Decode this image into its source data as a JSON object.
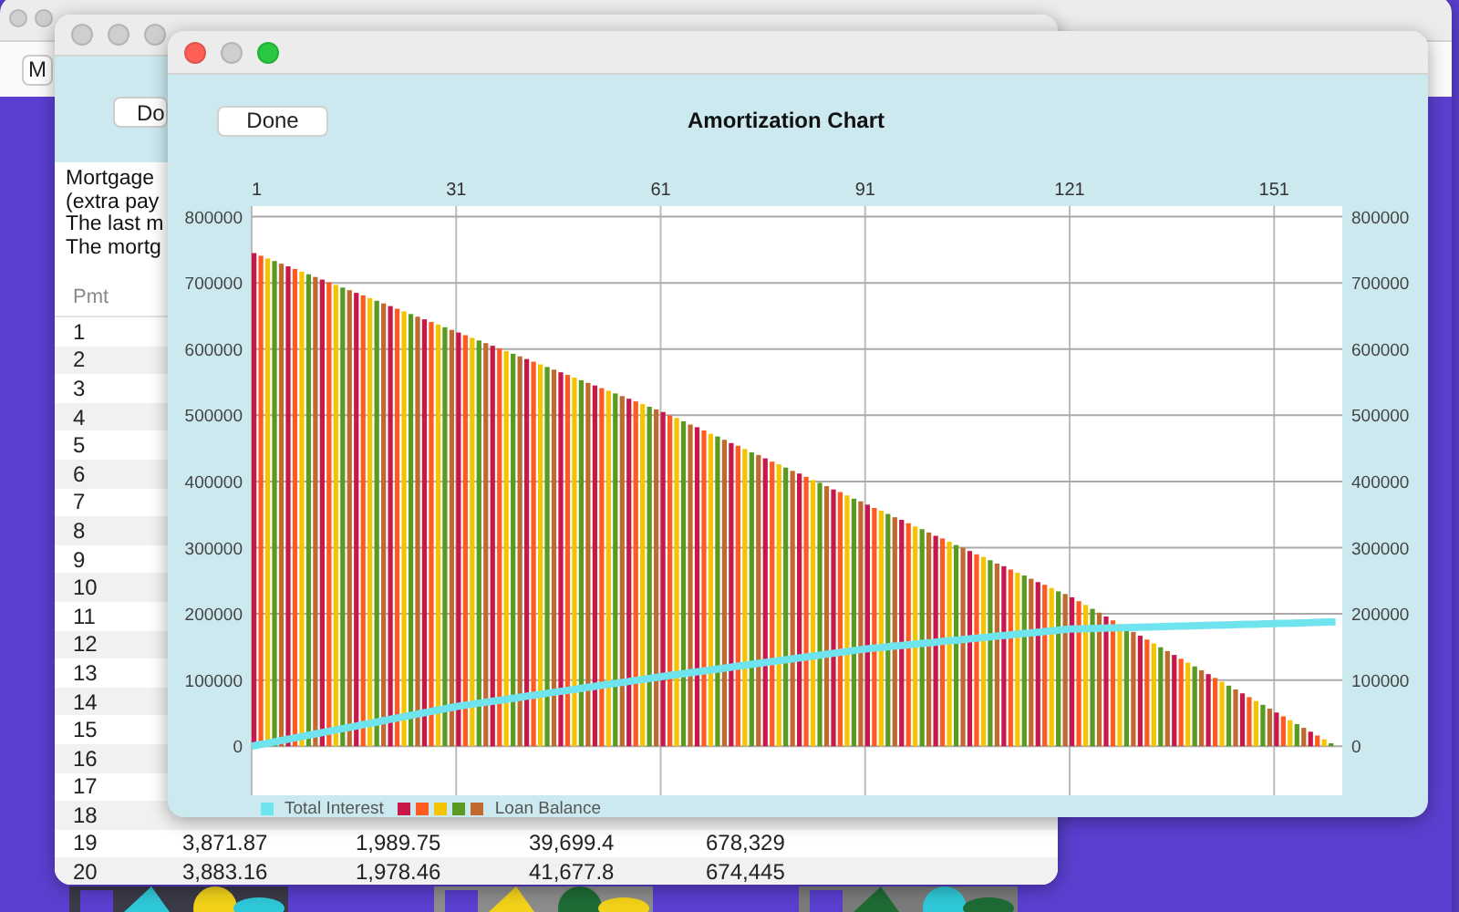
{
  "back_window": {
    "toolbar_button": "M"
  },
  "schedule_window": {
    "done_button": "Do",
    "summary": [
      "Mortgage",
      "(extra pay",
      "The last m",
      "The mortg"
    ],
    "table": {
      "columns": [
        "Pmt"
      ],
      "rows": [
        {
          "cells": [
            "1"
          ]
        },
        {
          "cells": [
            "2"
          ]
        },
        {
          "cells": [
            "3"
          ]
        },
        {
          "cells": [
            "4"
          ]
        },
        {
          "cells": [
            "5"
          ]
        },
        {
          "cells": [
            "6"
          ]
        },
        {
          "cells": [
            "7"
          ]
        },
        {
          "cells": [
            "8"
          ]
        },
        {
          "cells": [
            "9"
          ]
        },
        {
          "cells": [
            "10"
          ]
        },
        {
          "cells": [
            "11"
          ]
        },
        {
          "cells": [
            "12"
          ]
        },
        {
          "cells": [
            "13"
          ]
        },
        {
          "cells": [
            "14"
          ]
        },
        {
          "cells": [
            "15"
          ]
        },
        {
          "cells": [
            "16"
          ]
        },
        {
          "cells": [
            "17"
          ]
        },
        {
          "cells": [
            "18"
          ]
        },
        {
          "cells": [
            "19",
            "3,871.87",
            "1,989.75",
            "39,699.4",
            "678,329"
          ]
        },
        {
          "cells": [
            "20",
            "3,883.16",
            "1,978.46",
            "41,677.8",
            "674,445"
          ]
        }
      ]
    }
  },
  "chart_window": {
    "done_button": "Done",
    "title": "Amortization Chart",
    "right_axis_labels": [
      "800000",
      "700000",
      "600000",
      "500000",
      "400000",
      "300000",
      "200000",
      "100000",
      "0"
    ],
    "chart_data": {
      "type": "bar",
      "grid": true,
      "xlim": [
        1,
        161
      ],
      "ylim": [
        -74000,
        816000
      ],
      "xticks": [
        1,
        31,
        61,
        91,
        121,
        151
      ],
      "yticks": [
        0,
        100000,
        200000,
        300000,
        400000,
        500000,
        600000,
        700000,
        800000
      ],
      "x": [
        1,
        2,
        3,
        4,
        5,
        6,
        7,
        8,
        9,
        10,
        11,
        12,
        13,
        14,
        15,
        16,
        17,
        18,
        19,
        20,
        21,
        22,
        23,
        24,
        25,
        26,
        27,
        28,
        29,
        30,
        31,
        32,
        33,
        34,
        35,
        36,
        37,
        38,
        39,
        40,
        41,
        42,
        43,
        44,
        45,
        46,
        47,
        48,
        49,
        50,
        51,
        52,
        53,
        54,
        55,
        56,
        57,
        58,
        59,
        60,
        61,
        62,
        63,
        64,
        65,
        66,
        67,
        68,
        69,
        70,
        71,
        72,
        73,
        74,
        75,
        76,
        77,
        78,
        79,
        80,
        81,
        82,
        83,
        84,
        85,
        86,
        87,
        88,
        89,
        90,
        91,
        92,
        93,
        94,
        95,
        96,
        97,
        98,
        99,
        100,
        101,
        102,
        103,
        104,
        105,
        106,
        107,
        108,
        109,
        110,
        111,
        112,
        113,
        114,
        115,
        116,
        117,
        118,
        119,
        120,
        121,
        122,
        123,
        124,
        125,
        126,
        127,
        128,
        129,
        130,
        131,
        132,
        133,
        134,
        135,
        136,
        137,
        138,
        139,
        140,
        141,
        142,
        143,
        144,
        145,
        146,
        147,
        148,
        149,
        150,
        151,
        152,
        153,
        154,
        155,
        156,
        157,
        158,
        159,
        160
      ],
      "series": [
        {
          "name": "Total Interest",
          "type": "line",
          "color": "#6fe3ee",
          "values": [
            0,
            2000,
            4000,
            6000,
            8000,
            10000,
            12000,
            14000,
            16000,
            18000,
            20000,
            22000,
            24000,
            26000,
            28000,
            30000,
            32000,
            34000,
            36000,
            38000,
            40000,
            42000,
            44000,
            46000,
            48000,
            50000,
            52000,
            54000,
            56000,
            58000,
            60000,
            61500,
            63000,
            64500,
            66000,
            67500,
            69000,
            70500,
            72000,
            73500,
            75000,
            76500,
            78000,
            79500,
            81000,
            82500,
            84000,
            85500,
            87000,
            88500,
            90000,
            91500,
            93000,
            94500,
            96000,
            97500,
            99000,
            100500,
            102000,
            103500,
            105000,
            106400,
            107800,
            109200,
            110600,
            112000,
            113400,
            114800,
            116200,
            117600,
            119000,
            120400,
            121800,
            123200,
            124600,
            126000,
            127400,
            128800,
            130200,
            131600,
            133000,
            134400,
            135800,
            137200,
            138600,
            140000,
            141400,
            142800,
            144200,
            145600,
            147000,
            148000,
            149000,
            150000,
            151000,
            152000,
            153000,
            154000,
            155000,
            156000,
            157000,
            158000,
            159000,
            160000,
            161000,
            162000,
            163000,
            164000,
            165000,
            166000,
            167000,
            168000,
            169000,
            170000,
            171000,
            172000,
            173000,
            174000,
            175000,
            176000,
            177000,
            177280,
            177560,
            177840,
            178120,
            178400,
            178680,
            178960,
            179240,
            179520,
            179800,
            180080,
            180360,
            180640,
            180920,
            181200,
            181480,
            181760,
            182040,
            182320,
            182600,
            182880,
            183160,
            183440,
            183720,
            184000,
            184280,
            184560,
            184840,
            185120,
            185400,
            185680,
            185960,
            186240,
            186520,
            186800,
            187080,
            187360,
            187640,
            187920
          ]
        },
        {
          "name": "Loan Balance",
          "type": "bar",
          "colors": [
            "#c8184a",
            "#ff5a1f",
            "#f5c400",
            "#5a9a20",
            "#c06a30",
            "#c8184a",
            "#ff5a1f",
            "#f5c400",
            "#5a9a20",
            "#c06a30",
            "#c8184a",
            "#ff5a1f",
            "#f5c400",
            "#5a9a20",
            "#c06a30",
            "#c8184a",
            "#ff5a1f",
            "#f5c400",
            "#5a9a20",
            "#c06a30",
            "#c8184a",
            "#ff5a1f",
            "#f5c400",
            "#5a9a20",
            "#c06a30",
            "#c8184a",
            "#ff5a1f",
            "#f5c400",
            "#5a9a20",
            "#c06a30",
            "#c8184a",
            "#ff5a1f",
            "#f5c400",
            "#5a9a20",
            "#c06a30",
            "#c8184a",
            "#ff5a1f",
            "#f5c400",
            "#5a9a20",
            "#c06a30",
            "#c8184a",
            "#ff5a1f",
            "#f5c400",
            "#5a9a20",
            "#c06a30",
            "#c8184a",
            "#ff5a1f",
            "#f5c400",
            "#5a9a20",
            "#c06a30",
            "#c8184a",
            "#ff5a1f",
            "#f5c400",
            "#5a9a20",
            "#c06a30",
            "#c8184a",
            "#ff5a1f",
            "#f5c400",
            "#5a9a20",
            "#c06a30",
            "#c8184a",
            "#ff5a1f",
            "#f5c400",
            "#5a9a20",
            "#c06a30",
            "#c8184a",
            "#ff5a1f",
            "#f5c400",
            "#5a9a20",
            "#c06a30",
            "#c8184a",
            "#ff5a1f",
            "#f5c400",
            "#5a9a20",
            "#c06a30",
            "#c8184a",
            "#ff5a1f",
            "#f5c400",
            "#5a9a20",
            "#c06a30",
            "#c8184a",
            "#ff5a1f",
            "#f5c400",
            "#5a9a20",
            "#c06a30",
            "#c8184a",
            "#ff5a1f",
            "#f5c400",
            "#5a9a20",
            "#c06a30",
            "#c8184a",
            "#ff5a1f",
            "#f5c400",
            "#5a9a20",
            "#c06a30",
            "#c8184a",
            "#ff5a1f",
            "#f5c400",
            "#5a9a20",
            "#c06a30",
            "#c8184a",
            "#ff5a1f",
            "#f5c400",
            "#5a9a20",
            "#c06a30",
            "#c8184a",
            "#ff5a1f",
            "#f5c400",
            "#5a9a20",
            "#c06a30",
            "#c8184a",
            "#ff5a1f",
            "#f5c400",
            "#5a9a20",
            "#c06a30",
            "#c8184a",
            "#ff5a1f",
            "#f5c400",
            "#5a9a20",
            "#c06a30",
            "#c8184a",
            "#ff5a1f",
            "#f5c400",
            "#5a9a20",
            "#c06a30",
            "#c8184a",
            "#ff5a1f",
            "#f5c400",
            "#5a9a20",
            "#c06a30",
            "#c8184a",
            "#ff5a1f",
            "#f5c400",
            "#5a9a20",
            "#c06a30",
            "#c8184a",
            "#ff5a1f",
            "#f5c400",
            "#5a9a20",
            "#c06a30",
            "#c8184a",
            "#ff5a1f",
            "#f5c400",
            "#5a9a20",
            "#c06a30",
            "#c8184a",
            "#ff5a1f",
            "#f5c400",
            "#5a9a20",
            "#c06a30",
            "#c8184a",
            "#ff5a1f",
            "#f5c400",
            "#5a9a20",
            "#c06a30",
            "#c8184a",
            "#ff5a1f",
            "#f5c400",
            "#5a9a20",
            "#c06a30"
          ],
          "values": [
            745000,
            741000,
            737000,
            733000,
            729000,
            725000,
            721000,
            717000,
            713000,
            709000,
            705000,
            701000,
            697000,
            693000,
            689000,
            685000,
            681000,
            677000,
            673000,
            669000,
            665000,
            661000,
            657000,
            653000,
            649000,
            645000,
            641000,
            637000,
            633000,
            629000,
            625000,
            621000,
            617000,
            613000,
            609000,
            605000,
            601000,
            597000,
            593000,
            589000,
            585000,
            581000,
            577000,
            573000,
            569000,
            565000,
            561000,
            557000,
            553000,
            549000,
            545000,
            541000,
            537000,
            533000,
            529000,
            525000,
            521000,
            517000,
            513000,
            509000,
            505000,
            500000,
            496000,
            491000,
            486000,
            482000,
            477000,
            472000,
            468000,
            463000,
            458000,
            454000,
            449000,
            444000,
            440000,
            435000,
            430000,
            426000,
            421000,
            416000,
            412000,
            407000,
            402000,
            398000,
            393000,
            388000,
            384000,
            379000,
            374000,
            370000,
            365000,
            360000,
            356000,
            351000,
            346000,
            342000,
            337000,
            332000,
            328000,
            323000,
            318000,
            314000,
            309000,
            304000,
            300000,
            295000,
            290000,
            286000,
            281000,
            276000,
            272000,
            267000,
            262000,
            258000,
            253000,
            248000,
            244000,
            239000,
            234000,
            230000,
            225000,
            219200,
            213400,
            207600,
            201800,
            196000,
            190200,
            184400,
            178600,
            172800,
            167000,
            161200,
            155400,
            149600,
            143800,
            138000,
            132200,
            126400,
            120600,
            114800,
            109000,
            103200,
            97400,
            91600,
            85800,
            80000,
            74200,
            68400,
            62600,
            56800,
            51000,
            45200,
            39400,
            33600,
            27800,
            22000,
            16200,
            10400,
            4600,
            0
          ]
        }
      ]
    }
  }
}
